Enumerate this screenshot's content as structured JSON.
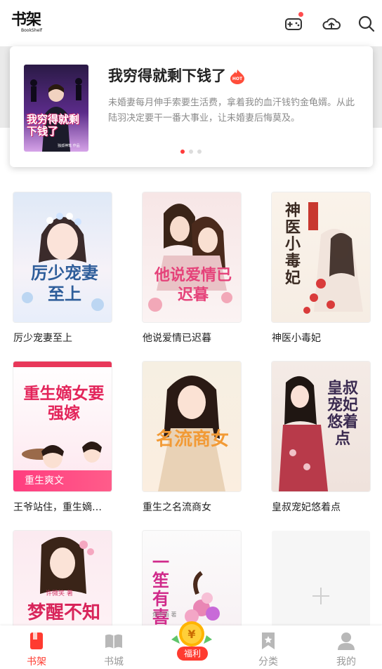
{
  "header": {
    "logo_cn": "书架",
    "logo_en": "BookShelf",
    "icons": [
      "gamepad-icon",
      "cloud-icon",
      "search-icon"
    ],
    "has_notification": true
  },
  "featured": {
    "title": "我穷得就剩下钱了",
    "hot_badge": "HOT",
    "description": "未婚妻每月伸手索要生活费，拿着我的血汗钱钓金龟婿。从此陆羽决定要干一番大事业，让未婚妻后悔莫及。",
    "cover_text": "我穷得就剩下钱了",
    "cover_author": "独孤神笔 作品",
    "carousel_count": 3,
    "carousel_active": 0
  },
  "books": [
    {
      "title": "厉少宠妻至上",
      "cover_text": "厉少宠妻至上"
    },
    {
      "title": "他说爱情已迟暮",
      "cover_text": "他说爱情已迟暮"
    },
    {
      "title": "神医小毒妃",
      "cover_text": "神医小毒妃"
    },
    {
      "title": "王爷站住，重生嫡…",
      "cover_text": "重生嫡女要强嫁",
      "badge": "重生爽文"
    },
    {
      "title": "重生之名流商女",
      "cover_text": "名流商女"
    },
    {
      "title": "皇叔宠妃悠着点",
      "cover_text": "皇叔宠妃悠着点"
    },
    {
      "title": "",
      "cover_text": "梦醒不知",
      "author": "许微笑 著"
    },
    {
      "title": "",
      "cover_text": "一笙有喜",
      "author": "焦不语 著"
    },
    {
      "title": "",
      "is_add": true
    }
  ],
  "bottom_nav": {
    "items": [
      {
        "label": "书架",
        "icon": "bookshelf-icon",
        "active": true
      },
      {
        "label": "书城",
        "icon": "bookstore-icon",
        "active": false
      },
      {
        "label": "福利",
        "icon": "coin-icon",
        "active": false
      },
      {
        "label": "分类",
        "icon": "category-icon",
        "active": false
      },
      {
        "label": "我的",
        "icon": "profile-icon",
        "active": false
      }
    ],
    "fuli_coin": "¥"
  },
  "colors": {
    "accent": "#ff3b30",
    "text": "#222222",
    "muted": "#8a8a8a"
  }
}
